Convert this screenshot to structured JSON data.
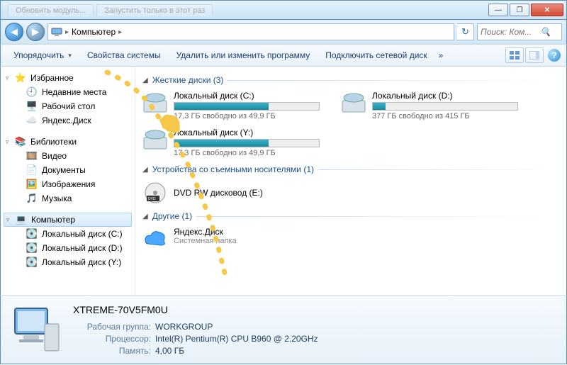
{
  "titlebar": {
    "tabs": [
      "Обновить модуль...",
      "Запустить только в этот раз"
    ]
  },
  "address": {
    "location": "Компьютер",
    "search_placeholder": "Поиск: Ком..."
  },
  "toolbar": {
    "organize": "Упорядочить",
    "props": "Свойства системы",
    "uninstall": "Удалить или изменить программу",
    "netdrive": "Подключить сетевой диск",
    "more": "»"
  },
  "nav": {
    "fav": "Избранное",
    "fav_items": [
      "Недавние места",
      "Рабочий стол",
      "Яндекс.Диск"
    ],
    "lib": "Библиотеки",
    "lib_items": [
      "Видео",
      "Документы",
      "Изображения",
      "Музыка"
    ],
    "computer": "Компьютер",
    "comp_items": [
      "Локальный диск (C:)",
      "Локальный диск (D:)",
      "Локальный диск (Y:)"
    ]
  },
  "content": {
    "cat_hdd": "Жесткие диски (3)",
    "cat_removable": "Устройства со съемными носителями (1)",
    "cat_other": "Другие (1)",
    "drives": [
      {
        "name": "Локальный диск (C:)",
        "free": "17,3 ГБ свободно из 49,9 ГБ",
        "pct": 65
      },
      {
        "name": "Локальный диск (D:)",
        "free": "377 ГБ свободно из 415 ГБ",
        "pct": 9
      },
      {
        "name": "Локальный диск (Y:)",
        "free": "17,3 ГБ свободно из 49,9 ГБ",
        "pct": 65
      }
    ],
    "dvd": "DVD RW дисковод (E:)",
    "other": {
      "name": "Яндекс.Диск",
      "sub": "Системная папка"
    }
  },
  "details": {
    "name": "XTREME-70V5FM0U",
    "labels": {
      "wg": "Рабочая группа:",
      "cpu": "Процессор:",
      "mem": "Память:"
    },
    "values": {
      "wg": "WORKGROUP",
      "cpu": "Intel(R) Pentium(R) CPU B960 @ 2.20GHz",
      "mem": "4,00 ГБ"
    }
  }
}
